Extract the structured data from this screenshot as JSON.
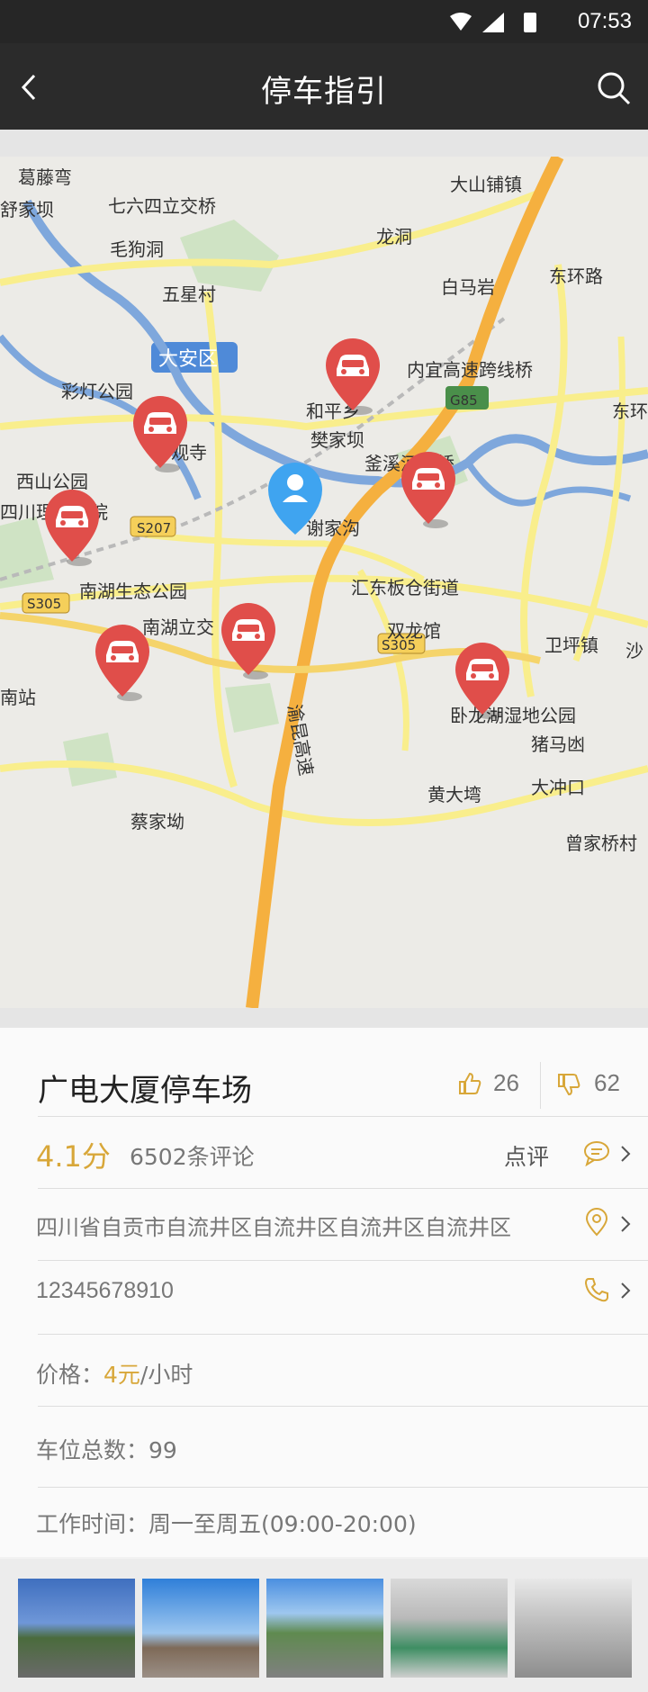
{
  "status_bar": {
    "time": "07:53"
  },
  "navbar": {
    "title": "停车指引"
  },
  "map": {
    "labels": [
      "葛藤弯",
      "舒家坝",
      "七六四立交桥",
      "大山铺镇",
      "毛狗洞",
      "龙洞",
      "五星村",
      "白马岩",
      "东环路",
      "大安区",
      "内宜高速跨线桥",
      "彩灯公园",
      "和平乡",
      "G85",
      "妙观寺",
      "樊家坝",
      "东环路",
      "西山公园",
      "釜溪河大桥",
      "四川理工学院",
      "S207",
      "南湖生态公园",
      "汇东板仓街道",
      "S305",
      "南湖立交",
      "双龙馆",
      "卫坪镇",
      "沙",
      "S305",
      "卧龙湖湿地公园",
      "南站",
      "渝昆高速",
      "猪马凼",
      "大冲口",
      "黄大塆",
      "蔡家坳",
      "曾家桥村",
      "谢家沟"
    ]
  },
  "parking": {
    "name": "广电大厦停车场",
    "likes": "26",
    "dislikes": "62",
    "score": "4.1分",
    "reviews": "6502条评论",
    "review_action": "点评",
    "address": "四川省自贡市自流井区自流井区自流井区自流井区",
    "phone": "12345678910",
    "price_label": "价格：",
    "price_value": "4元",
    "price_unit": "/小时",
    "spaces": "车位总数：99",
    "hours": "工作时间：周一至周五(09:00-20:00)"
  },
  "colors": {
    "accent": "#d8a739",
    "marker": "#e04e4a",
    "user": "#3fa4f0",
    "expressway": "#f5b03f",
    "road": "#f9ee8c",
    "river": "#7ea7dc"
  }
}
